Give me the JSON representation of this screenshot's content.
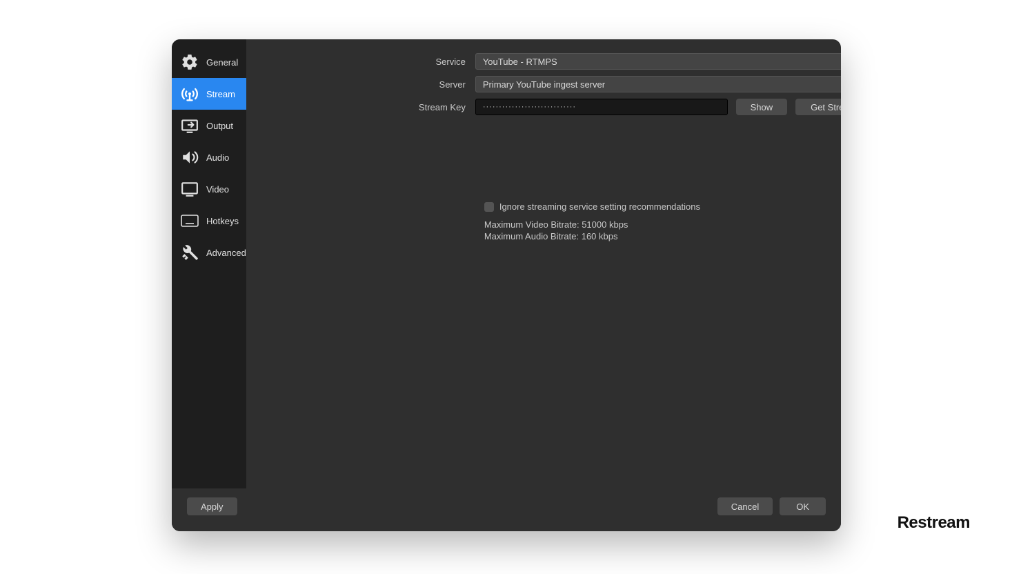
{
  "sidebar": {
    "items": [
      {
        "label": "General",
        "icon": "gear-icon"
      },
      {
        "label": "Stream",
        "icon": "stream-icon"
      },
      {
        "label": "Output",
        "icon": "output-icon"
      },
      {
        "label": "Audio",
        "icon": "audio-icon"
      },
      {
        "label": "Video",
        "icon": "video-icon"
      },
      {
        "label": "Hotkeys",
        "icon": "hotkeys-icon"
      },
      {
        "label": "Advanced",
        "icon": "advanced-icon"
      }
    ],
    "active_index": 1
  },
  "form": {
    "service_label": "Service",
    "service_value": "YouTube - RTMPS",
    "server_label": "Server",
    "server_value": "Primary YouTube ingest server",
    "stream_key_label": "Stream Key",
    "stream_key_masked": "·····························",
    "show_button": "Show",
    "get_key_button": "Get Stream Key"
  },
  "info": {
    "ignore_label": "Ignore streaming service setting recommendations",
    "max_video": "Maximum Video Bitrate: 51000 kbps",
    "max_audio": "Maximum Audio Bitrate: 160 kbps"
  },
  "footer": {
    "apply": "Apply",
    "cancel": "Cancel",
    "ok": "OK"
  },
  "watermark": "Restream"
}
